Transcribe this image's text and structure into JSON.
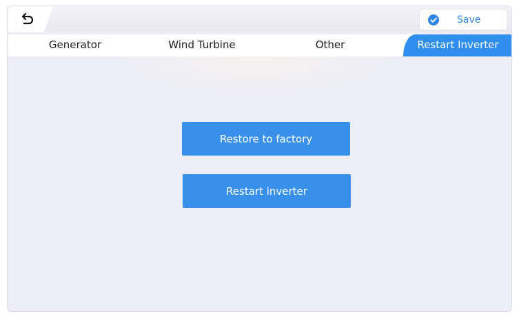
{
  "header": {
    "back_icon": "back-arrow-icon",
    "save_icon": "check-circle-icon",
    "save_label": "Save"
  },
  "tabs": [
    {
      "label": "Generator",
      "active": false
    },
    {
      "label": "Wind Turbine",
      "active": false
    },
    {
      "label": "Other",
      "active": false
    },
    {
      "label": "Restart Inverter",
      "active": true
    }
  ],
  "actions": {
    "restore_label": "Restore to factory",
    "restart_label": "Restart inverter"
  },
  "colors": {
    "accent": "#2f8ef0",
    "button": "#3990ea",
    "background": "#ecedf6"
  }
}
